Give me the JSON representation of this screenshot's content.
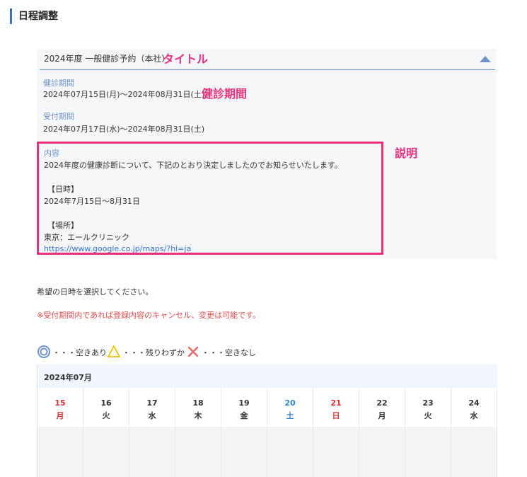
{
  "header": {
    "title": "日程調整"
  },
  "panel": {
    "title": "2024年度 一般健診予約（本社）",
    "annotation_title": "タイトル",
    "period_label": "健診期間",
    "period_value": "2024年07月15日(月)〜2024年08月31日(土)",
    "annotation_period": "健診期間",
    "reception_label": "受付期間",
    "reception_value": "2024年07月17日(水)〜2024年08月31日(土)",
    "content_label": "内容",
    "content_lines": [
      "2024年度の健康診断について、下記のとおり決定しましたのでお知らせいたします。",
      "【日時】",
      "2024年7月15日〜8月31日",
      "【場所】",
      "東京：エールクリニック"
    ],
    "content_link": "https://www.google.co.jp/maps/?hl=ja",
    "annotation_desc": "説明"
  },
  "instruction": "希望の日時を選択してください。",
  "note": "※受付期間内であれば登録内容のキャンセル、変更は可能です。",
  "legend": {
    "available": "・・・空きあり",
    "few": "・・・残りわずか",
    "none": "・・・空きなし"
  },
  "calendar": {
    "month": "2024年07月",
    "days": [
      {
        "date": "15",
        "weekday": "月",
        "color": "red"
      },
      {
        "date": "16",
        "weekday": "火",
        "color": "normal"
      },
      {
        "date": "17",
        "weekday": "水",
        "color": "normal"
      },
      {
        "date": "18",
        "weekday": "木",
        "color": "normal"
      },
      {
        "date": "19",
        "weekday": "金",
        "color": "normal"
      },
      {
        "date": "20",
        "weekday": "土",
        "color": "blue"
      },
      {
        "date": "21",
        "weekday": "日",
        "color": "red"
      },
      {
        "date": "22",
        "weekday": "月",
        "color": "normal"
      },
      {
        "date": "23",
        "weekday": "火",
        "color": "normal"
      },
      {
        "date": "24",
        "weekday": "水",
        "color": "normal"
      }
    ]
  },
  "colors": {
    "accent": "#6f93c9",
    "annotation": "#e8317a",
    "link": "#3b6fd4",
    "note": "#e04c4c"
  }
}
